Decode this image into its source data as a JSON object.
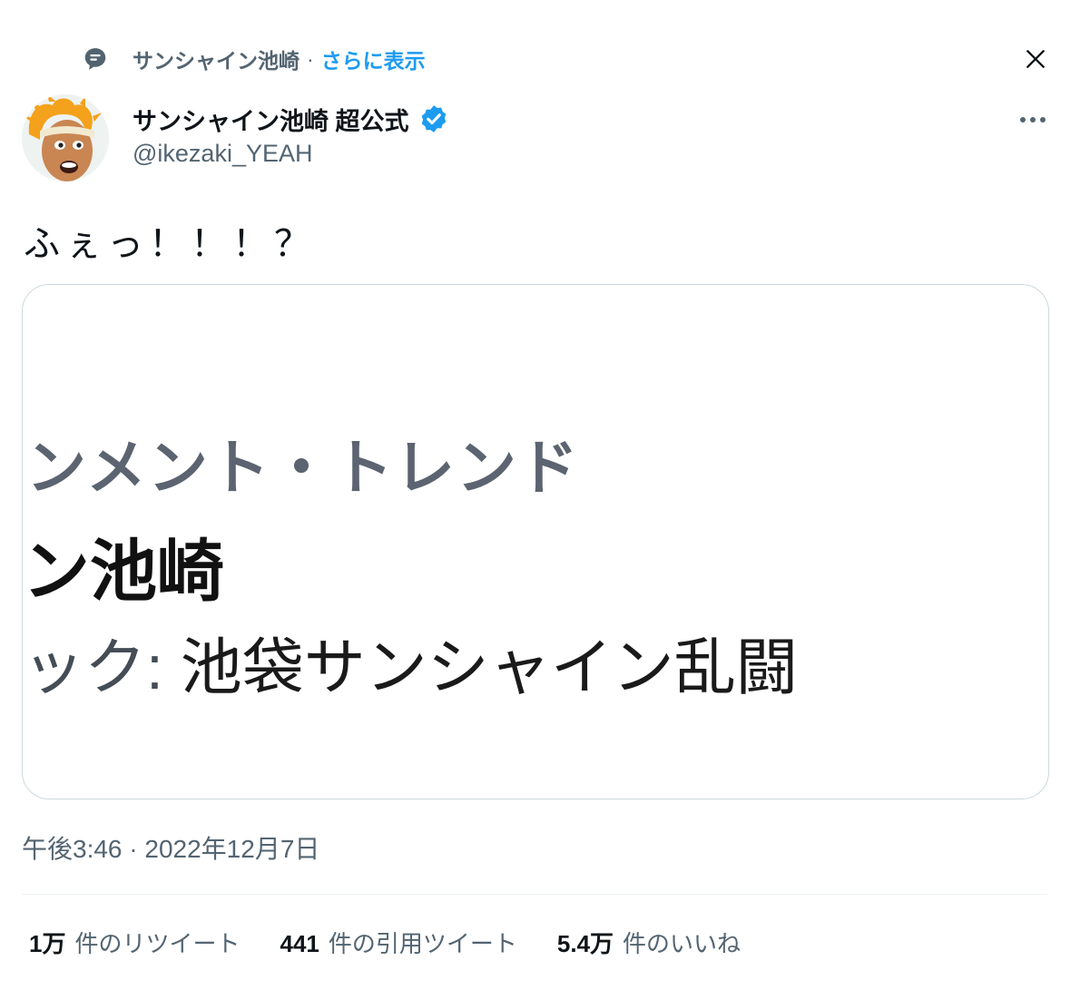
{
  "context": {
    "icon": "speech-bubble-icon",
    "author": "サンシャイン池崎",
    "separator": "·",
    "show_more": "さらに表示"
  },
  "header": {
    "close_icon": "close-icon",
    "display_name": "サンシャイン池崎 超公式",
    "handle": "@ikezaki_YEAH",
    "more_icon": "more-icon"
  },
  "tweet": {
    "text": "ふぇっ！！！？",
    "timestamp": "午後3:46 · 2022年12月7日"
  },
  "media": {
    "line1": "ンメント・トレンド",
    "line2": "ン池崎",
    "line3_prefix": "ック:",
    "line3_rest": " 池袋サンシャイン乱闘"
  },
  "stats": [
    {
      "count": "1万",
      "label": "件のリツイート"
    },
    {
      "count": "441",
      "label": "件の引用ツイート"
    },
    {
      "count": "5.4万",
      "label": "件のいいね"
    }
  ],
  "colors": {
    "accent": "#1d9bf0",
    "secondary_text": "#536471",
    "border": "#cfd9de"
  }
}
